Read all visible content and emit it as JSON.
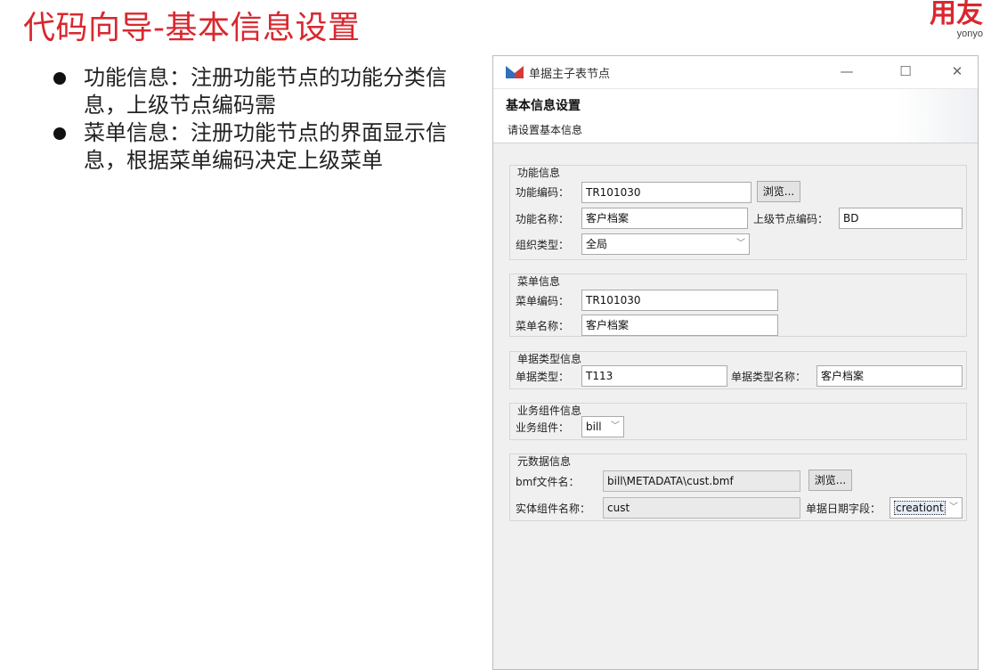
{
  "slide": {
    "title": "代码向导-基本信息设置",
    "logo_text": "用友",
    "logo_sub": "yonyo",
    "bullets": [
      "功能信息：注册功能节点的功能分类信息，上级节点编码需",
      "菜单信息：注册功能节点的界面显示信息，根据菜单编码决定上级菜单"
    ]
  },
  "window": {
    "title": "单据主子表节点",
    "minimize": "—",
    "maximize": "☐",
    "close": "✕",
    "header_title": "基本信息设置",
    "header_desc": "请设置基本信息"
  },
  "function_info": {
    "group_title": "功能信息",
    "code_label": "功能编码：",
    "code_value": "TR101030",
    "browse_label": "浏览...",
    "name_label": "功能名称：",
    "name_value": "客户档案",
    "parent_code_label": "上级节点编码：",
    "parent_code_value": "BD",
    "org_type_label": "组织类型：",
    "org_type_value": "全局"
  },
  "menu_info": {
    "group_title": "菜单信息",
    "code_label": "菜单编码：",
    "code_value": "TR101030",
    "name_label": "菜单名称：",
    "name_value": "客户档案"
  },
  "bill_type_info": {
    "group_title": "单据类型信息",
    "type_label": "单据类型：",
    "type_value": "T113",
    "type_name_label": "单据类型名称：",
    "type_name_value": "客户档案"
  },
  "business_component": {
    "group_title": "业务组件信息",
    "label": "业务组件：",
    "value": "bill"
  },
  "metadata_info": {
    "group_title": "元数据信息",
    "bmf_label": "bmf文件名：",
    "bmf_value": "bill\\METADATA\\cust.bmf",
    "browse_label": "浏览...",
    "entity_label": "实体组件名称：",
    "entity_value": "cust",
    "date_field_label": "单据日期字段：",
    "date_field_value": "creationt"
  },
  "colors": {
    "title_red": "#d8282f",
    "dialog_bg": "#f0f0f0",
    "icon_blue": "#2f6fbf",
    "icon_red": "#d33a3a"
  }
}
